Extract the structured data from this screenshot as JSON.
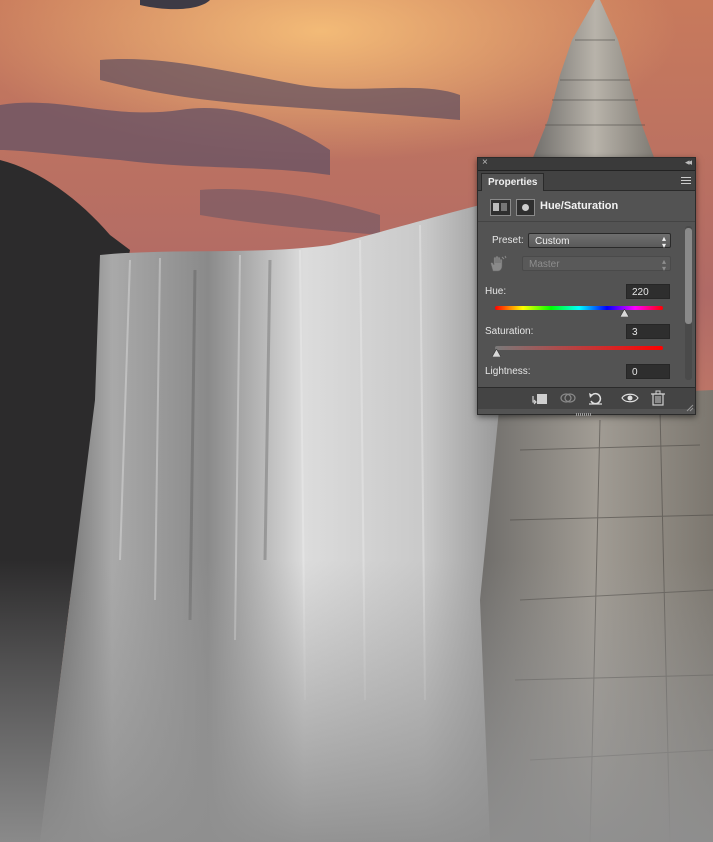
{
  "panel": {
    "close_glyph": "×",
    "collapse_glyph": "◂◂",
    "tab_label": "Properties",
    "menu_icon": "panel-menu-icon",
    "header_title": "Hue/Saturation",
    "preset_label": "Preset:",
    "preset_value": "Custom",
    "channel_value": "Master",
    "hue": {
      "label": "Hue:",
      "value": "220",
      "slider_fraction": 0.77
    },
    "saturation": {
      "label": "Saturation:",
      "value": "3",
      "slider_fraction": 0.01
    },
    "lightness": {
      "label": "Lightness:",
      "value": "0"
    },
    "icons": {
      "adjustment": "adjustment-layer-icon",
      "mask": "layer-mask-icon",
      "targeted_adjustment": "hand-tool-icon",
      "clip_to_layer": "clip-to-layer-icon",
      "view_previous": "view-previous-state-icon",
      "reset": "reset-icon",
      "visibility": "eye-icon",
      "delete": "trash-icon"
    },
    "colors": {
      "panel_bg": "#535353",
      "hue_gradient": [
        "#ff0000",
        "#ffff00",
        "#00ff00",
        "#00ffff",
        "#0000ff",
        "#ff00ff",
        "#ff0000"
      ],
      "saturation_gradient": [
        "#7a7a7a",
        "#ff0000"
      ]
    }
  },
  "scene": {
    "description_icon": "photo-canvas"
  }
}
